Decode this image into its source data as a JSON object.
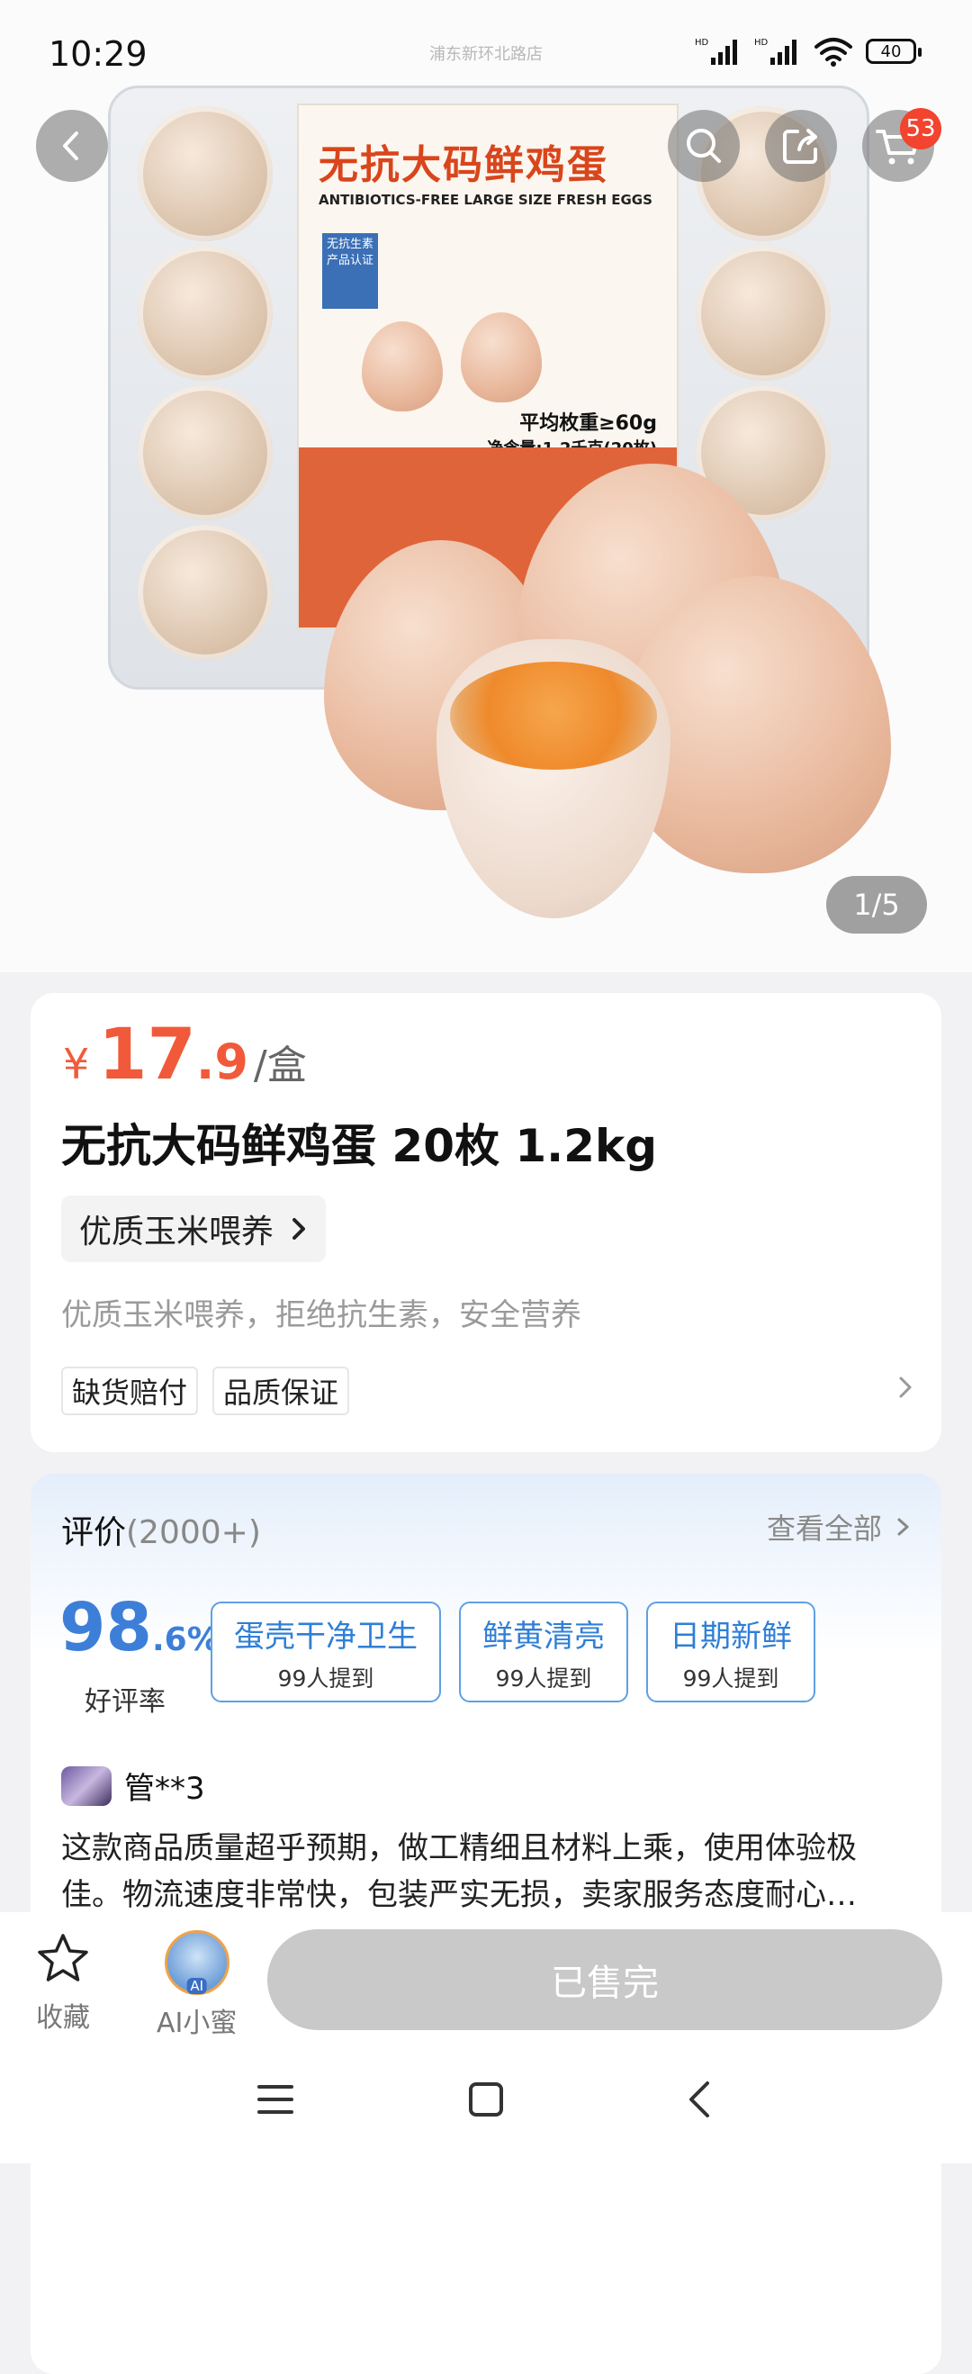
{
  "status_bar": {
    "time": "10:29",
    "location": "浦东新环北路店",
    "battery": "40"
  },
  "gallery": {
    "cart_count": "53",
    "counter": "1/5",
    "package_title": "无抗大码鲜鸡蛋",
    "package_subtitle": "ANTIBIOTICS-FREE LARGE SIZE FRESH EGGS",
    "package_badge": "无抗生素 产品认证",
    "package_weight": "平均枚重≥60g",
    "package_net": "净含量:1.2千克(20枚)"
  },
  "product": {
    "currency": "¥",
    "price_int": "17",
    "price_dec": ".9",
    "unit": "/盒",
    "title": "无抗大码鲜鸡蛋 20枚 1.2kg",
    "feature_chip": "优质玉米喂养",
    "description": "优质玉米喂养，拒绝抗生素，安全营养",
    "tags": [
      "缺货赔付",
      "品质保证"
    ]
  },
  "reviews": {
    "label": "评价",
    "count": "(2000+)",
    "view_all": "查看全部",
    "rate_int": "98",
    "rate_dec": ".6%",
    "rate_label": "好评率",
    "keywords": [
      {
        "text": "蛋壳干净卫生",
        "sub": "99人提到"
      },
      {
        "text": "鲜黄清亮",
        "sub": "99人提到"
      },
      {
        "text": "日期新鲜",
        "sub": "99人提到"
      }
    ],
    "reviewer": "管**3",
    "text": "这款商品质量超乎预期，做工精细且材料上乘，使用体验极佳。物流速度非常快，包装严实无损，卖家服务态度耐心…"
  },
  "bottom_bar": {
    "favorite_label": "收藏",
    "ai_label": "AI小蜜",
    "ai_badge": "AI",
    "soldout_label": "已售完"
  },
  "colors": {
    "price": "#f05a3a",
    "accent_blue": "#2f7fd6",
    "badge_red": "#f2442e"
  }
}
